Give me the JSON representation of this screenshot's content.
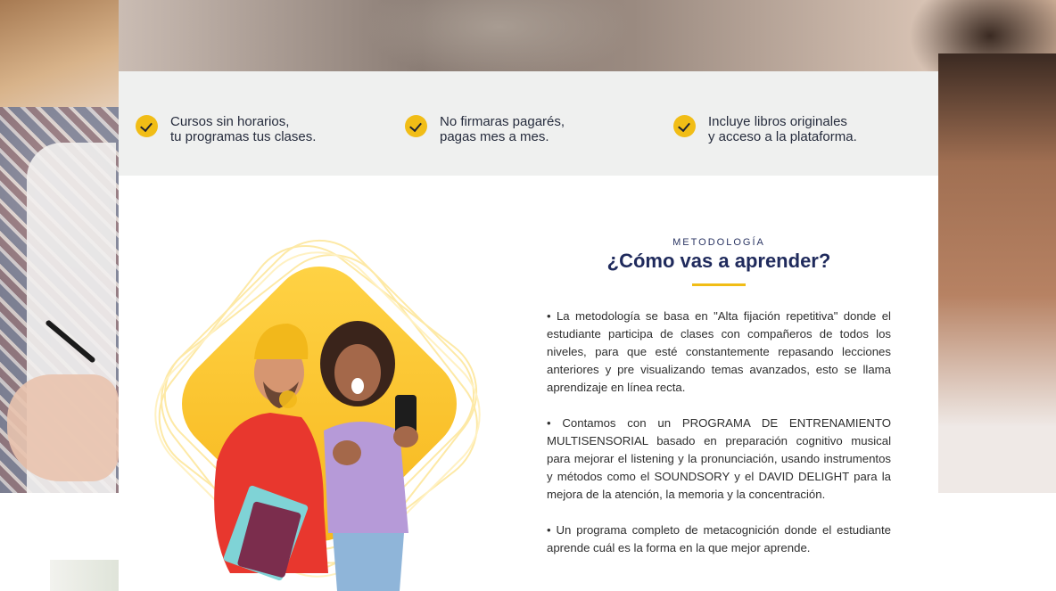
{
  "features": [
    {
      "line1": "Cursos sin horarios,",
      "line2": "tu programas tus clases."
    },
    {
      "line1": "No firmaras pagarés,",
      "line2": "pagas mes a mes."
    },
    {
      "line1": "Incluye libros originales",
      "line2": "y acceso a la plataforma."
    }
  ],
  "section": {
    "eyebrow": "METODOLOGÍA",
    "title": "¿Cómo vas a aprender?"
  },
  "paragraphs": [
    "• La metodología se basa en \"Alta fijación repetitiva\" donde el estudiante participa de clases con compañeros de todos los niveles, para que esté constantemente repasando lecciones anteriores y pre visualizando temas avanzados, esto se llama aprendizaje en línea recta.",
    "• Contamos con un PROGRAMA DE ENTRENAMIENTO MULTISENSORIAL basado en preparación cognitivo musical para mejorar el listening y la pronunciación, usando instrumentos y métodos como el SOUNDSORY y el DAVID DELIGHT para la mejora de la atención, la memoria y la concentración.",
    "• Un programa completo de metacognición donde el estudiante aprende cuál es la forma en la que mejor aprende."
  ],
  "colors": {
    "accent": "#f1bd16",
    "heading": "#1f2a5c",
    "feature_bg": "#eff0ef"
  },
  "icons": [
    "check-icon"
  ]
}
